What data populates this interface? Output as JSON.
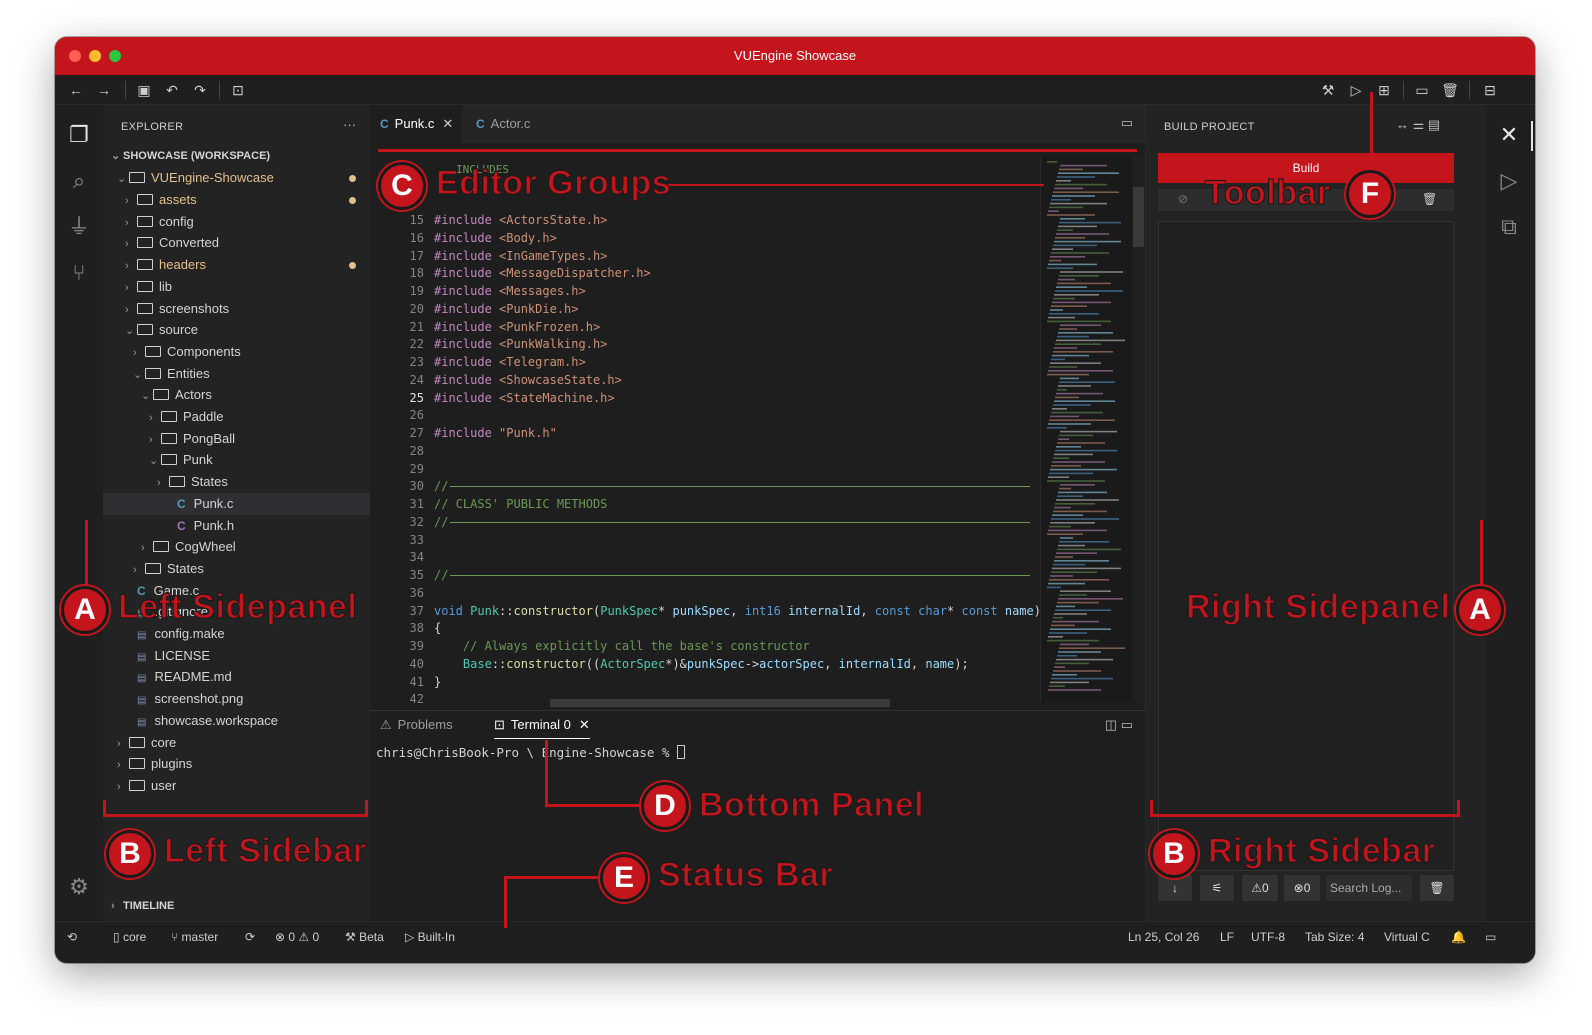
{
  "window": {
    "title": "VUEngine Showcase"
  },
  "explorer": {
    "header": "EXPLORER",
    "more": "···",
    "workspace": "SHOWCASE (WORKSPACE)",
    "project": "VUEngine-Showcase",
    "items": [
      {
        "label": "assets",
        "type": "folder",
        "modified": true
      },
      {
        "label": "config",
        "type": "folder"
      },
      {
        "label": "Converted",
        "type": "folder"
      },
      {
        "label": "headers",
        "type": "folder",
        "modified": true
      },
      {
        "label": "lib",
        "type": "folder"
      },
      {
        "label": "screenshots",
        "type": "folder"
      },
      {
        "label": "source",
        "type": "folder",
        "open": true
      },
      {
        "label": "Components",
        "type": "folder"
      },
      {
        "label": "Entities",
        "type": "folder",
        "open": true
      },
      {
        "label": "Actors",
        "type": "folder",
        "open": true
      },
      {
        "label": "Paddle",
        "type": "folder"
      },
      {
        "label": "PongBall",
        "type": "folder"
      },
      {
        "label": "Punk",
        "type": "folder",
        "open": true
      },
      {
        "label": "States",
        "type": "folder"
      },
      {
        "label": "Punk.c",
        "type": "c"
      },
      {
        "label": "Punk.h",
        "type": "h"
      },
      {
        "label": "CogWheel",
        "type": "folder"
      },
      {
        "label": "States",
        "type": "folder"
      },
      {
        "label": "Game.c",
        "type": "c"
      },
      {
        "label": ".gitignore",
        "type": "file"
      },
      {
        "label": "config.make",
        "type": "file"
      },
      {
        "label": "LICENSE",
        "type": "file"
      },
      {
        "label": "README.md",
        "type": "file"
      },
      {
        "label": "screenshot.png",
        "type": "file"
      },
      {
        "label": "showcase.workspace",
        "type": "file"
      },
      {
        "label": "core",
        "type": "folder"
      },
      {
        "label": "plugins",
        "type": "folder"
      },
      {
        "label": "user",
        "type": "folder"
      }
    ],
    "timeline": "TIMELINE"
  },
  "editor": {
    "tabs": [
      {
        "label": "Punk.c",
        "active": true
      },
      {
        "label": "Actor.c",
        "active": false
      }
    ],
    "breadcrumb_fragment": "INCLUDES",
    "lines": [
      {
        "n": "15",
        "t": "#include <ActorsState.h>"
      },
      {
        "n": "16",
        "t": "#include <Body.h>"
      },
      {
        "n": "17",
        "t": "#include <InGameTypes.h>"
      },
      {
        "n": "18",
        "t": "#include <MessageDispatcher.h>"
      },
      {
        "n": "19",
        "t": "#include <Messages.h>"
      },
      {
        "n": "20",
        "t": "#include <PunkDie.h>"
      },
      {
        "n": "21",
        "t": "#include <PunkFrozen.h>"
      },
      {
        "n": "22",
        "t": "#include <PunkWalking.h>"
      },
      {
        "n": "23",
        "t": "#include <Telegram.h>"
      },
      {
        "n": "24",
        "t": "#include <ShowcaseState.h>"
      },
      {
        "n": "25",
        "t": "#include <StateMachine.h>"
      },
      {
        "n": "26",
        "t": ""
      },
      {
        "n": "27",
        "t": "#include \"Punk.h\""
      },
      {
        "n": "28",
        "t": ""
      },
      {
        "n": "29",
        "t": ""
      },
      {
        "n": "30",
        "t": "//"
      },
      {
        "n": "31",
        "t": "// CLASS' PUBLIC METHODS"
      },
      {
        "n": "32",
        "t": "//"
      },
      {
        "n": "33",
        "t": ""
      },
      {
        "n": "34",
        "t": ""
      },
      {
        "n": "35",
        "t": "//"
      },
      {
        "n": "36",
        "t": ""
      },
      {
        "n": "37",
        "t": "void Punk::constructor(PunkSpec* punkSpec, int16 internalId, const char* const name)"
      },
      {
        "n": "38",
        "t": "{"
      },
      {
        "n": "39",
        "t": "    // Always explicitly call the base's constructor"
      },
      {
        "n": "40",
        "t": "    Base::constructor((ActorSpec*)&punkSpec->actorSpec, internalId, name);"
      },
      {
        "n": "41",
        "t": "}"
      },
      {
        "n": "42",
        "t": ""
      }
    ]
  },
  "bottom": {
    "tabs": [
      {
        "label": "Problems"
      },
      {
        "label": "Terminal 0"
      }
    ],
    "terminal": "chris@ChrisBook-Pro \\ Engine-Showcase % "
  },
  "right": {
    "header": "BUILD PROJECT",
    "build_label": "Build",
    "warnings": "0",
    "errors": "0",
    "search_placeholder": "Search Log..."
  },
  "status": {
    "core": "core",
    "branch": "master",
    "problems": "0 ⚠ 0",
    "beta": "Beta",
    "builtin": "Built-In",
    "position": "Ln 25, Col 26",
    "eol": "LF",
    "encoding": "UTF-8",
    "tabsize": "Tab Size: 4",
    "lang": "Virtual C"
  },
  "annotations": {
    "editor_groups": "Editor Groups",
    "toolbar": "Toolbar",
    "left_sidepanel": "Left Sidepanel",
    "right_sidepanel": "Right Sidepanel",
    "left_sidebar": "Left Sidebar",
    "right_sidebar": "Right Sidebar",
    "bottom_panel": "Bottom Panel",
    "status_bar": "Status Bar",
    "badges": {
      "a": "A",
      "b": "B",
      "c": "C",
      "d": "D",
      "e": "E",
      "f": "F"
    }
  },
  "colors": {
    "accent": "#c4151c",
    "bg": "#1e1e1e"
  }
}
